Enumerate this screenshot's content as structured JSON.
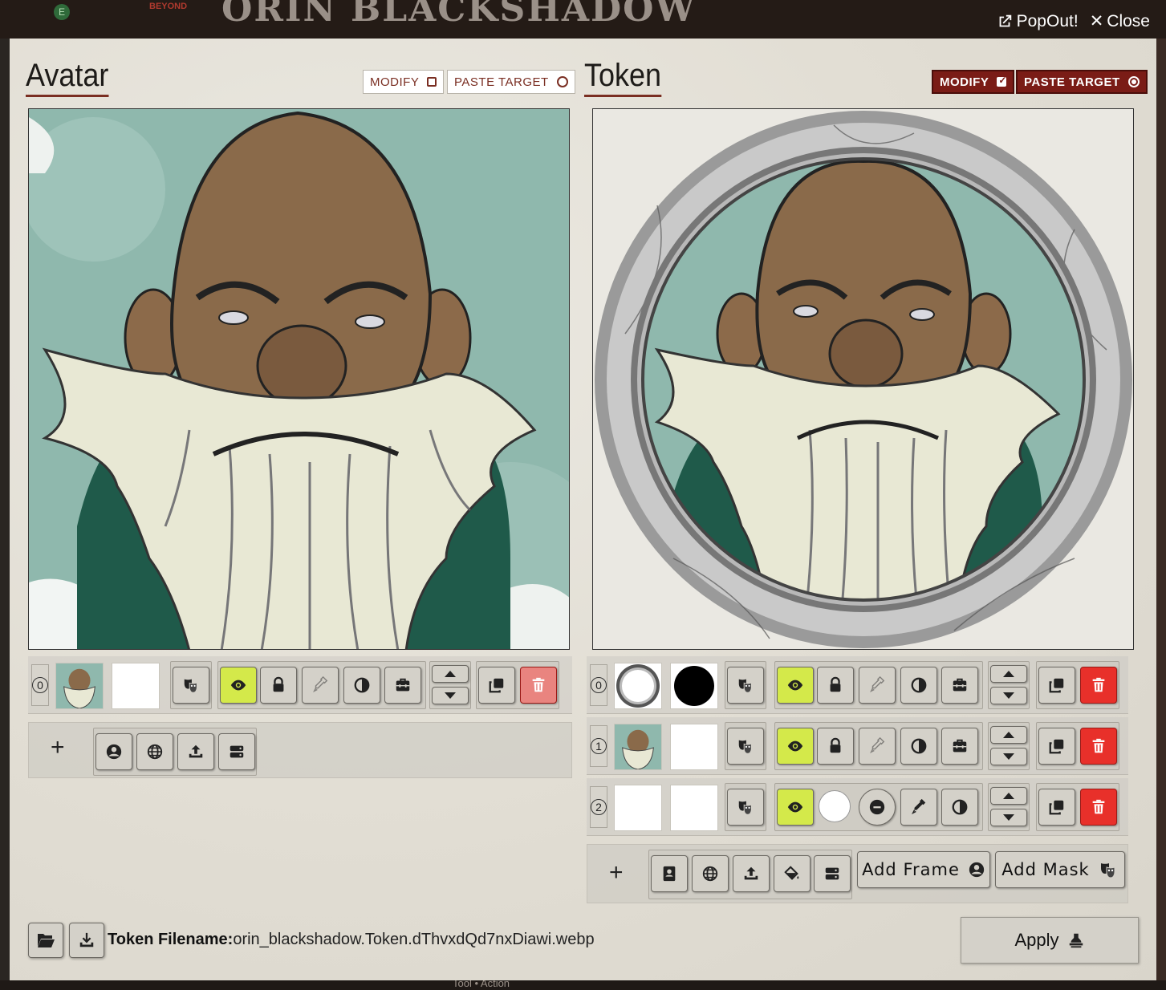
{
  "window": {
    "title": "ORIN BLACKSHADOW",
    "brand": "BEYOND",
    "badge": "E",
    "popout_label": "PopOut!",
    "close_label": "Close",
    "bottom_hint": "Tool • Action"
  },
  "avatar": {
    "title": "Avatar",
    "modify_label": "MODIFY",
    "paste_target_label": "PASTE TARGET",
    "modify_checked": false,
    "paste_target_selected": false,
    "layers": [
      {
        "index": "0",
        "has_image": true,
        "mask_thumb": "blank",
        "visible_active": true,
        "delete_disabled": true
      }
    ]
  },
  "token": {
    "title": "Token",
    "modify_label": "MODIFY",
    "paste_target_label": "PASTE TARGET",
    "modify_checked": true,
    "paste_target_selected": true,
    "layers": [
      {
        "index": "0",
        "thumb": "frame-ring",
        "mask_thumb": "black-circle"
      },
      {
        "index": "1",
        "thumb": "portrait",
        "mask_thumb": "blank"
      },
      {
        "index": "2",
        "thumb": "blank",
        "mask_thumb": "blank",
        "fill_color": "#ffffff"
      }
    ],
    "add_frame_label": "Add Frame",
    "add_mask_label": "Add Mask"
  },
  "footer": {
    "filename_label": "Token Filename:",
    "filename_value": "orin_blackshadow.Token.dThvxdQd7nxDiawi.webp",
    "apply_label": "Apply"
  },
  "colors": {
    "accent": "#7a1c16",
    "highlight": "#d4e94a",
    "danger": "#e8302a"
  }
}
